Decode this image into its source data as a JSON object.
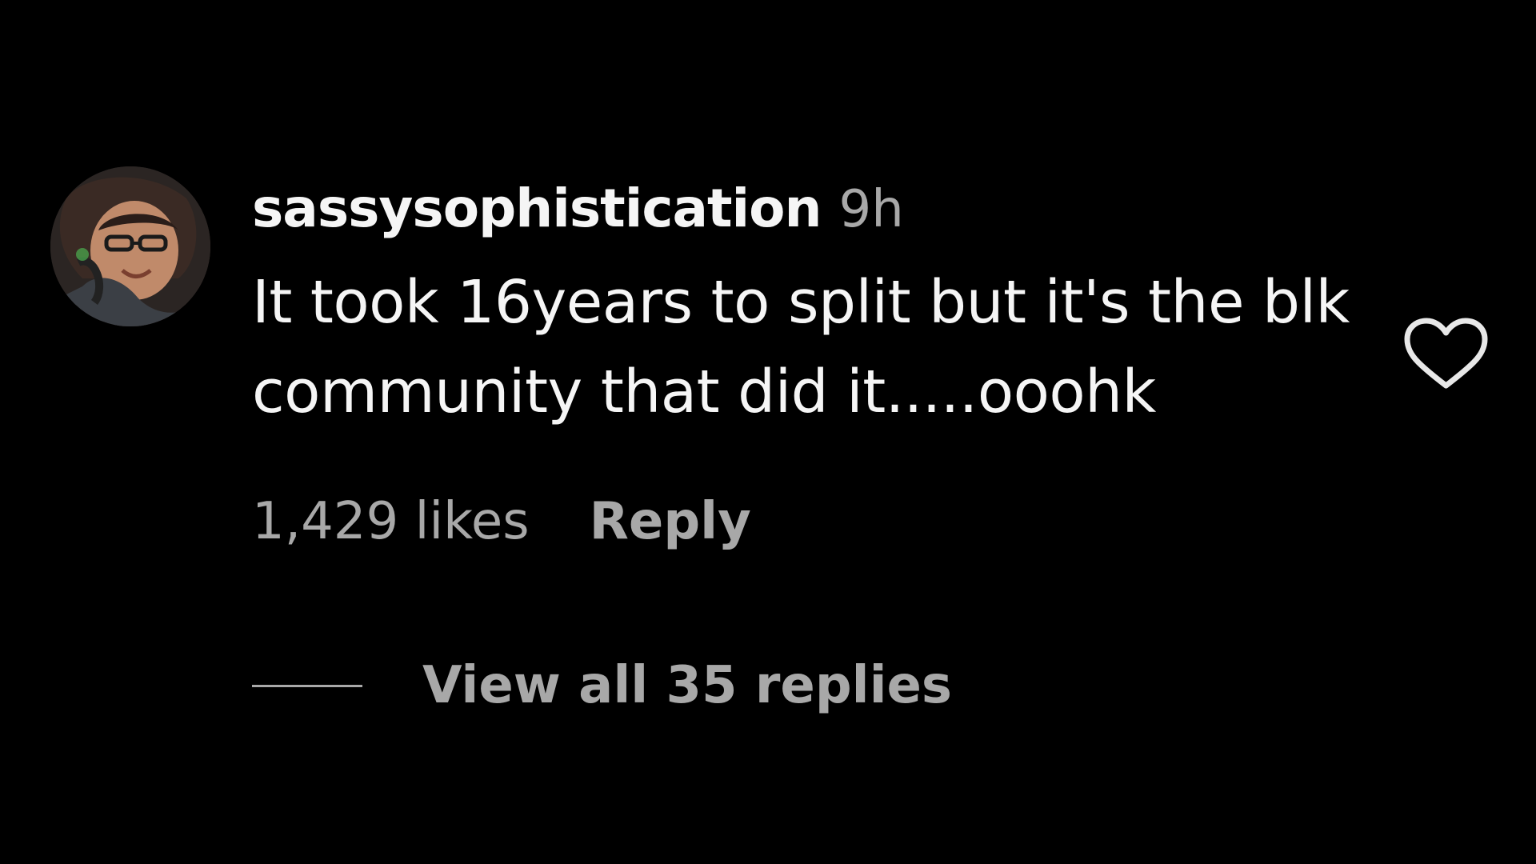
{
  "comment": {
    "username": "sassysophistication",
    "timestamp": "9h",
    "text": "It took 16years to split but it's the blk community that did it.....ooohk",
    "likes": "1,429 likes",
    "reply_label": "Reply",
    "view_replies_label": "View all 35 replies"
  },
  "icons": {
    "like": "heart-icon",
    "avatar": "profile-photo"
  },
  "colors": {
    "background": "#000000",
    "primary_text": "#f5f5f5",
    "secondary_text": "#a8a8a8"
  }
}
